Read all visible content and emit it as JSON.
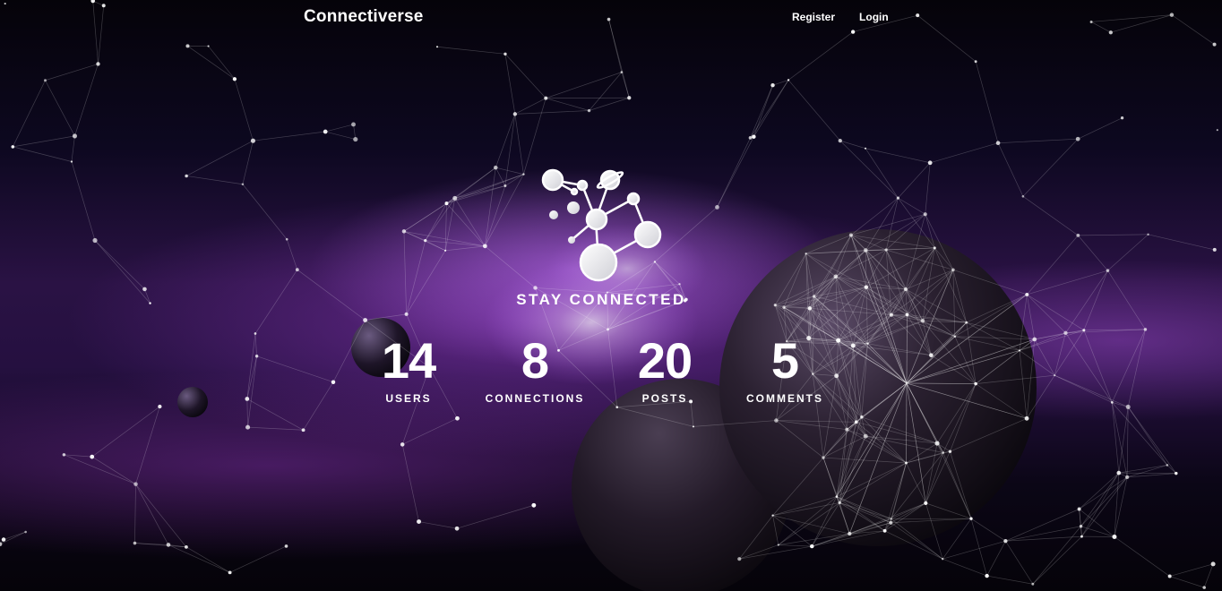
{
  "nav": {
    "brand": "Connectiverse",
    "register_label": "Register",
    "login_label": "Login"
  },
  "hero": {
    "logo_icon": "molecule-network-icon",
    "tagline": "STAY CONNECTED"
  },
  "stats": [
    {
      "value": "14",
      "label": "USERS"
    },
    {
      "value": "8",
      "label": "CONNECTIONS"
    },
    {
      "value": "20",
      "label": "POSTS"
    },
    {
      "value": "5",
      "label": "COMMENTS"
    }
  ],
  "colors": {
    "background": "#07040f",
    "nebula": "#9b3fd0",
    "text": "#ffffff"
  }
}
